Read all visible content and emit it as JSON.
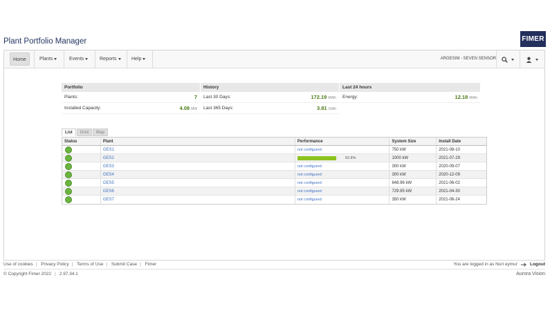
{
  "app": {
    "title": "Plant Portfolio Manager",
    "logo": "FIMER"
  },
  "nav": {
    "items": [
      {
        "label": "Home",
        "active": true
      },
      {
        "label": "Plants"
      },
      {
        "label": "Events"
      },
      {
        "label": "Reports"
      },
      {
        "label": "Help"
      }
    ],
    "user": "ARGESIM - SEVEN SENSOR",
    "search_icon": "search-icon",
    "user_icon": "user-icon"
  },
  "portfolio": {
    "header": "Portfolio",
    "plants_label": "Plants:",
    "plants_value": "7",
    "capacity_label": "Installed Capacity:",
    "capacity_value": "4.08",
    "capacity_unit": "MW"
  },
  "history": {
    "header": "History",
    "d30_label": "Last 30 Days:",
    "d30_value": "172.19",
    "d30_unit": "MWh",
    "d365_label": "Last 365 Days:",
    "d365_value": "3.81",
    "d365_unit": "GWh"
  },
  "last24": {
    "header": "Last 24 hours",
    "energy_label": "Energy:",
    "energy_value": "12.18",
    "energy_unit": "MWh"
  },
  "tabs": [
    "List",
    "Grid",
    "Map"
  ],
  "table": {
    "columns": [
      "Status",
      "Plant",
      "Performance",
      "System Size",
      "Install Date"
    ],
    "rows": [
      {
        "plant": "GES1",
        "performance": "not configured",
        "size": "750 kW",
        "date": "2021-08-10"
      },
      {
        "plant": "GES2",
        "performance": "92.8%",
        "perf_fraction": 0.928,
        "size": "1000 kW",
        "date": "2021-07-29"
      },
      {
        "plant": "GES3",
        "performance": "not configured",
        "size": "300 kW",
        "date": "2020-09-07"
      },
      {
        "plant": "GES4",
        "performance": "not configured",
        "size": "300 kW",
        "date": "2020-12-09"
      },
      {
        "plant": "GES5",
        "performance": "not configured",
        "size": "648.96 kW",
        "date": "2021-06-02"
      },
      {
        "plant": "GES6",
        "performance": "not configured",
        "size": "729.95 kW",
        "date": "2021-04-30"
      },
      {
        "plant": "GES7",
        "performance": "not configured",
        "size": "350 kW",
        "date": "2021-06-24"
      }
    ]
  },
  "footer": {
    "links": [
      "Use of cookies",
      "Privacy Policy",
      "Terms of Use",
      "Submit Case",
      "Fimer"
    ],
    "logged_in": "You are logged in as Nuri eymur",
    "logout": "Logout",
    "copyright": "© Copyright Fimer 2022",
    "version": "2.97.34.1",
    "brand": "Aurora Vision"
  }
}
